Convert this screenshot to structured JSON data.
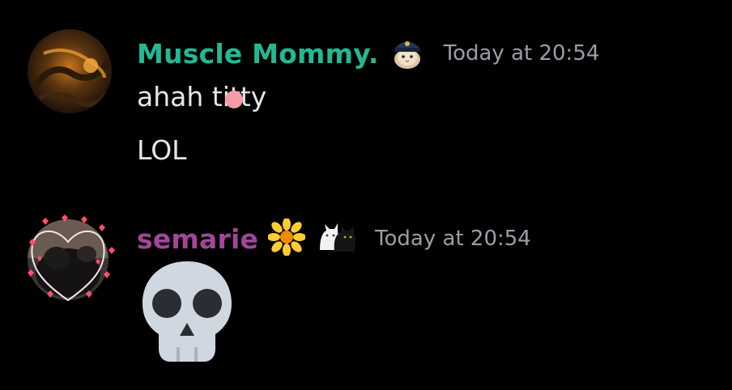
{
  "messages": [
    {
      "author": "Muscle Mommy.",
      "author_color": "#22b893",
      "badge_icon": "cat-police-cap-icon",
      "timestamp": "Today at 20:54",
      "lines": [
        "ahah titty",
        "LOL"
      ]
    },
    {
      "author": "semarie",
      "author_color": "#a2469a",
      "badge_icons": [
        "sunflower-icon",
        "cats-icon"
      ],
      "timestamp": "Today at 20:54",
      "content_emoji": "skull-icon"
    }
  ]
}
